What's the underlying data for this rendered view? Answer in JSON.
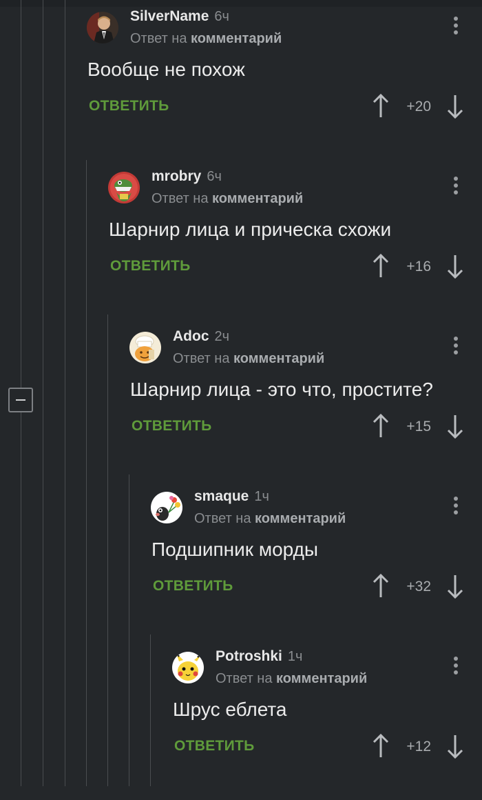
{
  "ui": {
    "reply_label": "ОТВЕТИТЬ",
    "reply_to_prefix": "Ответ на",
    "reply_to_target": "комментарий"
  },
  "colors": {
    "background": "#24272a",
    "reply_green": "#5f9b3b",
    "muted": "#8a8d90",
    "thread_line": "#4a4d50"
  },
  "comments": [
    {
      "username": "SilverName",
      "time": "6ч",
      "text": "Вообще не похож",
      "score": "+20",
      "avatar": "man-in-suit-avatar"
    },
    {
      "username": "mrobry",
      "time": "6ч",
      "text": "Шарнир лица и прическа схожи",
      "score": "+16",
      "avatar": "green-dinosaur-avatar"
    },
    {
      "username": "Adoc",
      "time": "2ч",
      "text": "Шарнир лица - это что, простите?",
      "score": "+15",
      "avatar": "chef-cartoon-avatar"
    },
    {
      "username": "smaque",
      "time": "1ч",
      "text": "Подшипник морды",
      "score": "+32",
      "avatar": "mole-with-flowers-avatar"
    },
    {
      "username": "Potroshki",
      "time": "1ч",
      "text": "Шрус еблета",
      "score": "+12",
      "avatar": "pikachu-avatar"
    }
  ]
}
